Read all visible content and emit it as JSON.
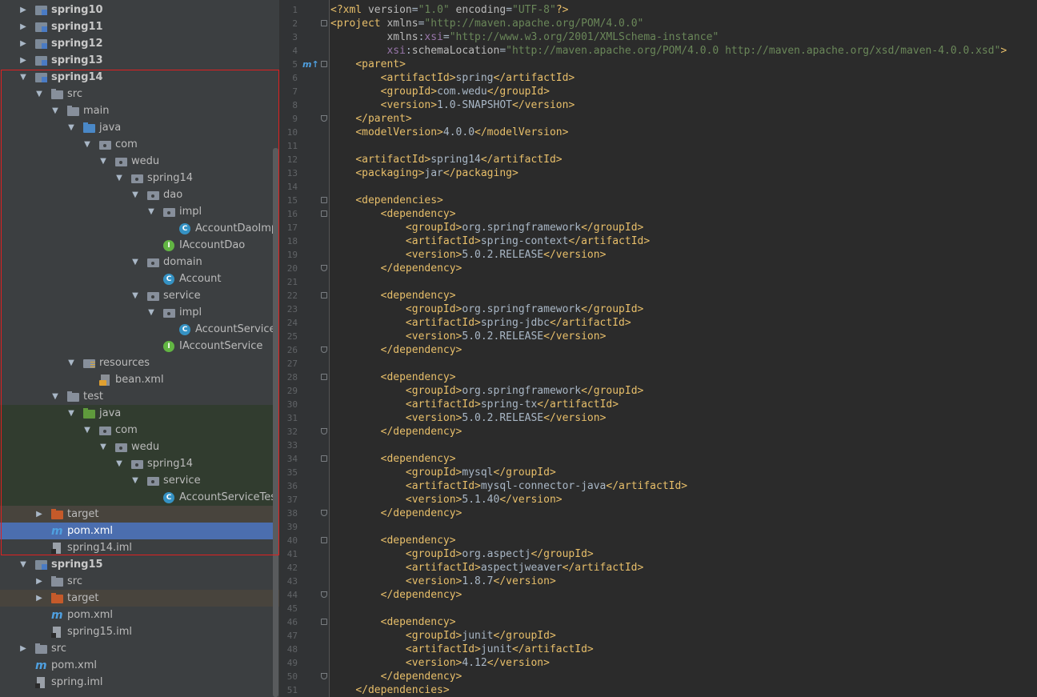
{
  "colors": {
    "background": "#2b2b2b",
    "tree_background": "#3c3f41",
    "selection": "#4b6eaf",
    "tag": "#e8bf6a",
    "string": "#6a8759",
    "text": "#a9b7c6",
    "highlight_border": "#e02020"
  },
  "project_tree": {
    "rows": [
      {
        "label": "spring10",
        "icon": "module-folder-icon",
        "depth": 1,
        "state": "collapsed",
        "bold": true
      },
      {
        "label": "spring11",
        "icon": "module-folder-icon",
        "depth": 1,
        "state": "collapsed",
        "bold": true
      },
      {
        "label": "spring12",
        "icon": "module-folder-icon",
        "depth": 1,
        "state": "collapsed",
        "bold": true
      },
      {
        "label": "spring13",
        "icon": "module-folder-icon",
        "depth": 1,
        "state": "collapsed",
        "bold": true
      },
      {
        "label": "spring14",
        "icon": "module-folder-icon",
        "depth": 1,
        "state": "expanded",
        "bold": true
      },
      {
        "label": "src",
        "icon": "folder-icon",
        "depth": 2,
        "state": "expanded"
      },
      {
        "label": "main",
        "icon": "folder-icon",
        "depth": 3,
        "state": "expanded"
      },
      {
        "label": "java",
        "icon": "source-root-icon",
        "depth": 4,
        "state": "expanded"
      },
      {
        "label": "com",
        "icon": "package-icon",
        "depth": 5,
        "state": "expanded"
      },
      {
        "label": "wedu",
        "icon": "package-icon",
        "depth": 6,
        "state": "expanded"
      },
      {
        "label": "spring14",
        "icon": "package-icon",
        "depth": 7,
        "state": "expanded"
      },
      {
        "label": "dao",
        "icon": "package-icon",
        "depth": 8,
        "state": "expanded"
      },
      {
        "label": "impl",
        "icon": "package-icon",
        "depth": 9,
        "state": "expanded"
      },
      {
        "label": "AccountDaoImpl",
        "icon": "class-icon",
        "depth": 10,
        "state": "leaf"
      },
      {
        "label": "IAccountDao",
        "icon": "interface-icon",
        "depth": 9,
        "state": "leaf"
      },
      {
        "label": "domain",
        "icon": "package-icon",
        "depth": 8,
        "state": "expanded"
      },
      {
        "label": "Account",
        "icon": "class-icon",
        "depth": 9,
        "state": "leaf"
      },
      {
        "label": "service",
        "icon": "package-icon",
        "depth": 8,
        "state": "expanded"
      },
      {
        "label": "impl",
        "icon": "package-icon",
        "depth": 9,
        "state": "expanded"
      },
      {
        "label": "AccountServiceImpl",
        "icon": "class-icon",
        "depth": 10,
        "state": "leaf"
      },
      {
        "label": "IAccountService",
        "icon": "interface-icon",
        "depth": 9,
        "state": "leaf"
      },
      {
        "label": "resources",
        "icon": "resources-root-icon",
        "depth": 4,
        "state": "expanded"
      },
      {
        "label": "bean.xml",
        "icon": "xml-file-icon",
        "depth": 5,
        "state": "leaf"
      },
      {
        "label": "test",
        "icon": "folder-icon",
        "depth": 3,
        "state": "expanded"
      },
      {
        "label": "java",
        "icon": "test-root-icon",
        "depth": 4,
        "state": "expanded",
        "bg": "test"
      },
      {
        "label": "com",
        "icon": "package-icon",
        "depth": 5,
        "state": "expanded",
        "bg": "test"
      },
      {
        "label": "wedu",
        "icon": "package-icon",
        "depth": 6,
        "state": "expanded",
        "bg": "test"
      },
      {
        "label": "spring14",
        "icon": "package-icon",
        "depth": 7,
        "state": "expanded",
        "bg": "test"
      },
      {
        "label": "service",
        "icon": "package-icon",
        "depth": 8,
        "state": "expanded",
        "bg": "test"
      },
      {
        "label": "AccountServiceTest",
        "icon": "class-icon",
        "depth": 9,
        "state": "leaf",
        "bg": "test"
      },
      {
        "label": "target",
        "icon": "excluded-folder-icon",
        "depth": 2,
        "state": "collapsed",
        "bg": "excluded"
      },
      {
        "label": "pom.xml",
        "icon": "maven-icon",
        "depth": 2,
        "state": "leaf",
        "selected": true
      },
      {
        "label": "spring14.iml",
        "icon": "iml-file-icon",
        "depth": 2,
        "state": "leaf"
      },
      {
        "label": "spring15",
        "icon": "module-folder-icon",
        "depth": 1,
        "state": "expanded",
        "bold": true
      },
      {
        "label": "src",
        "icon": "folder-icon",
        "depth": 2,
        "state": "collapsed"
      },
      {
        "label": "target",
        "icon": "excluded-folder-icon",
        "depth": 2,
        "state": "collapsed",
        "bg": "excluded"
      },
      {
        "label": "pom.xml",
        "icon": "maven-icon",
        "depth": 2,
        "state": "leaf"
      },
      {
        "label": "spring15.iml",
        "icon": "iml-file-icon",
        "depth": 2,
        "state": "leaf"
      },
      {
        "label": "src",
        "icon": "folder-icon",
        "depth": 1,
        "state": "collapsed"
      },
      {
        "label": "pom.xml",
        "icon": "maven-icon",
        "depth": 1,
        "state": "leaf"
      },
      {
        "label": "spring.iml",
        "icon": "iml-file-icon",
        "depth": 1,
        "state": "leaf"
      }
    ]
  },
  "editor": {
    "gutter_marker": {
      "line": 5,
      "icon": "maven-parent-icon",
      "glyph": "m↑"
    },
    "fold_open_lines": [
      2,
      5,
      15,
      16,
      22,
      28,
      34,
      40,
      46
    ],
    "fold_close_lines": [
      9,
      20,
      26,
      32,
      38,
      44,
      50
    ],
    "lines": [
      [
        [
          "pi",
          "<?xml "
        ],
        [
          "attr",
          "version"
        ],
        [
          "text",
          "="
        ],
        [
          "str",
          "\"1.0\""
        ],
        [
          "attr",
          " encoding"
        ],
        [
          "text",
          "="
        ],
        [
          "str",
          "\"UTF-8\""
        ],
        [
          "pi",
          "?>"
        ]
      ],
      [
        [
          "tag",
          "<project "
        ],
        [
          "attr",
          "xmlns"
        ],
        [
          "text",
          "="
        ],
        [
          "str",
          "\"http://maven.apache.org/POM/4.0.0\""
        ]
      ],
      [
        [
          "attr",
          "         xmlns"
        ],
        [
          "text",
          ":"
        ],
        [
          "ns",
          "xsi"
        ],
        [
          "text",
          "="
        ],
        [
          "str",
          "\"http://www.w3.org/2001/XMLSchema-instance\""
        ]
      ],
      [
        [
          "ns",
          "         xsi"
        ],
        [
          "text",
          ":"
        ],
        [
          "attr",
          "schemaLocation"
        ],
        [
          "text",
          "="
        ],
        [
          "str",
          "\"http://maven.apache.org/POM/4.0.0 http://maven.apache.org/xsd/maven-4.0.0.xsd\""
        ],
        [
          "tag",
          ">"
        ]
      ],
      [
        [
          "text",
          "    "
        ],
        [
          "tag",
          "<parent>"
        ]
      ],
      [
        [
          "text",
          "        "
        ],
        [
          "tag",
          "<artifactId>"
        ],
        [
          "text",
          "spring"
        ],
        [
          "tag",
          "</artifactId>"
        ]
      ],
      [
        [
          "text",
          "        "
        ],
        [
          "tag",
          "<groupId>"
        ],
        [
          "text",
          "com.wedu"
        ],
        [
          "tag",
          "</groupId>"
        ]
      ],
      [
        [
          "text",
          "        "
        ],
        [
          "tag",
          "<version>"
        ],
        [
          "text",
          "1.0-SNAPSHOT"
        ],
        [
          "tag",
          "</version>"
        ]
      ],
      [
        [
          "text",
          "    "
        ],
        [
          "tag",
          "</parent>"
        ]
      ],
      [
        [
          "text",
          "    "
        ],
        [
          "tag",
          "<modelVersion>"
        ],
        [
          "text",
          "4.0.0"
        ],
        [
          "tag",
          "</modelVersion>"
        ]
      ],
      [],
      [
        [
          "text",
          "    "
        ],
        [
          "tag",
          "<artifactId>"
        ],
        [
          "text",
          "spring14"
        ],
        [
          "tag",
          "</artifactId>"
        ]
      ],
      [
        [
          "text",
          "    "
        ],
        [
          "tag",
          "<packaging>"
        ],
        [
          "text",
          "jar"
        ],
        [
          "tag",
          "</packaging>"
        ]
      ],
      [],
      [
        [
          "text",
          "    "
        ],
        [
          "tag",
          "<dependencies>"
        ]
      ],
      [
        [
          "text",
          "        "
        ],
        [
          "tag",
          "<dependency>"
        ]
      ],
      [
        [
          "text",
          "            "
        ],
        [
          "tag",
          "<groupId>"
        ],
        [
          "text",
          "org.springframework"
        ],
        [
          "tag",
          "</groupId>"
        ]
      ],
      [
        [
          "text",
          "            "
        ],
        [
          "tag",
          "<artifactId>"
        ],
        [
          "text",
          "spring-context"
        ],
        [
          "tag",
          "</artifactId>"
        ]
      ],
      [
        [
          "text",
          "            "
        ],
        [
          "tag",
          "<version>"
        ],
        [
          "text",
          "5.0.2.RELEASE"
        ],
        [
          "tag",
          "</version>"
        ]
      ],
      [
        [
          "text",
          "        "
        ],
        [
          "tag",
          "</dependency>"
        ]
      ],
      [],
      [
        [
          "text",
          "        "
        ],
        [
          "tag",
          "<dependency>"
        ]
      ],
      [
        [
          "text",
          "            "
        ],
        [
          "tag",
          "<groupId>"
        ],
        [
          "text",
          "org.springframework"
        ],
        [
          "tag",
          "</groupId>"
        ]
      ],
      [
        [
          "text",
          "            "
        ],
        [
          "tag",
          "<artifactId>"
        ],
        [
          "text",
          "spring-jdbc"
        ],
        [
          "tag",
          "</artifactId>"
        ]
      ],
      [
        [
          "text",
          "            "
        ],
        [
          "tag",
          "<version>"
        ],
        [
          "text",
          "5.0.2.RELEASE"
        ],
        [
          "tag",
          "</version>"
        ]
      ],
      [
        [
          "text",
          "        "
        ],
        [
          "tag",
          "</dependency>"
        ]
      ],
      [],
      [
        [
          "text",
          "        "
        ],
        [
          "tag",
          "<dependency>"
        ]
      ],
      [
        [
          "text",
          "            "
        ],
        [
          "tag",
          "<groupId>"
        ],
        [
          "text",
          "org.springframework"
        ],
        [
          "tag",
          "</groupId>"
        ]
      ],
      [
        [
          "text",
          "            "
        ],
        [
          "tag",
          "<artifactId>"
        ],
        [
          "text",
          "spring-tx"
        ],
        [
          "tag",
          "</artifactId>"
        ]
      ],
      [
        [
          "text",
          "            "
        ],
        [
          "tag",
          "<version>"
        ],
        [
          "text",
          "5.0.2.RELEASE"
        ],
        [
          "tag",
          "</version>"
        ]
      ],
      [
        [
          "text",
          "        "
        ],
        [
          "tag",
          "</dependency>"
        ]
      ],
      [],
      [
        [
          "text",
          "        "
        ],
        [
          "tag",
          "<dependency>"
        ]
      ],
      [
        [
          "text",
          "            "
        ],
        [
          "tag",
          "<groupId>"
        ],
        [
          "text",
          "mysql"
        ],
        [
          "tag",
          "</groupId>"
        ]
      ],
      [
        [
          "text",
          "            "
        ],
        [
          "tag",
          "<artifactId>"
        ],
        [
          "text",
          "mysql-connector-java"
        ],
        [
          "tag",
          "</artifactId>"
        ]
      ],
      [
        [
          "text",
          "            "
        ],
        [
          "tag",
          "<version>"
        ],
        [
          "text",
          "5.1.40"
        ],
        [
          "tag",
          "</version>"
        ]
      ],
      [
        [
          "text",
          "        "
        ],
        [
          "tag",
          "</dependency>"
        ]
      ],
      [],
      [
        [
          "text",
          "        "
        ],
        [
          "tag",
          "<dependency>"
        ]
      ],
      [
        [
          "text",
          "            "
        ],
        [
          "tag",
          "<groupId>"
        ],
        [
          "text",
          "org.aspectj"
        ],
        [
          "tag",
          "</groupId>"
        ]
      ],
      [
        [
          "text",
          "            "
        ],
        [
          "tag",
          "<artifactId>"
        ],
        [
          "text",
          "aspectjweaver"
        ],
        [
          "tag",
          "</artifactId>"
        ]
      ],
      [
        [
          "text",
          "            "
        ],
        [
          "tag",
          "<version>"
        ],
        [
          "text",
          "1.8.7"
        ],
        [
          "tag",
          "</version>"
        ]
      ],
      [
        [
          "text",
          "        "
        ],
        [
          "tag",
          "</dependency>"
        ]
      ],
      [],
      [
        [
          "text",
          "        "
        ],
        [
          "tag",
          "<dependency>"
        ]
      ],
      [
        [
          "text",
          "            "
        ],
        [
          "tag",
          "<groupId>"
        ],
        [
          "text",
          "junit"
        ],
        [
          "tag",
          "</groupId>"
        ]
      ],
      [
        [
          "text",
          "            "
        ],
        [
          "tag",
          "<artifactId>"
        ],
        [
          "text",
          "junit"
        ],
        [
          "tag",
          "</artifactId>"
        ]
      ],
      [
        [
          "text",
          "            "
        ],
        [
          "tag",
          "<version>"
        ],
        [
          "text",
          "4.12"
        ],
        [
          "tag",
          "</version>"
        ]
      ],
      [
        [
          "text",
          "        "
        ],
        [
          "tag",
          "</dependency>"
        ]
      ],
      [
        [
          "text",
          "    "
        ],
        [
          "tag",
          "</dependencies>"
        ]
      ]
    ]
  }
}
